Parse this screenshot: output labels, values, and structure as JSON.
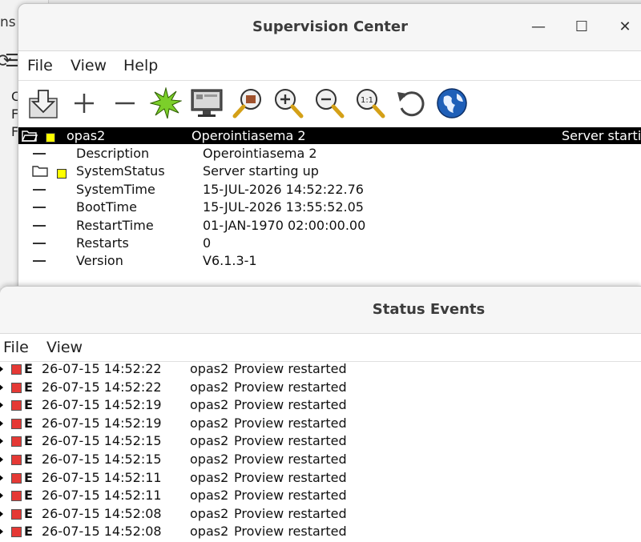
{
  "background_window": {
    "title_fragment": "ns",
    "letters": [
      "C",
      "F",
      "F"
    ]
  },
  "supervision": {
    "title": "Supervision Center",
    "controls": {
      "minimize": "—",
      "maximize": "☐",
      "close": "✕"
    },
    "menu": [
      "File",
      "View",
      "Help"
    ],
    "toolbar": [
      "download-icon",
      "add-icon",
      "remove-icon",
      "burst-icon",
      "monitor-icon",
      "zoom-object-icon",
      "zoom-in-icon",
      "zoom-out-icon",
      "zoom-reset-icon",
      "undo-icon",
      "globe-icon"
    ],
    "node": {
      "name": "opas2",
      "description": "Operointiasema 2",
      "status": "Server starting up",
      "status_color": "#ffff00"
    },
    "properties": [
      {
        "name": "Description",
        "value": "Operointiasema 2",
        "icon": "dash"
      },
      {
        "name": "SystemStatus",
        "value": "Server starting up",
        "icon": "folder"
      },
      {
        "name": "SystemTime",
        "value": "15-JUL-2026 14:52:22.76",
        "icon": "dash"
      },
      {
        "name": "BootTime",
        "value": "15-JUL-2026 13:55:52.05",
        "icon": "dash"
      },
      {
        "name": "RestartTime",
        "value": "01-JAN-1970 02:00:00.00",
        "icon": "dash"
      },
      {
        "name": "Restarts",
        "value": "0",
        "icon": "dash"
      },
      {
        "name": "Version",
        "value": "V6.1.3-1",
        "icon": "dash"
      }
    ]
  },
  "events": {
    "title": "Status Events",
    "menu": [
      "File",
      "View"
    ],
    "severity_color": "#e53935",
    "rows": [
      {
        "code": "E",
        "time": "26-07-15 14:52:22",
        "node": "opas2",
        "text": "Proview restarted"
      },
      {
        "code": "E",
        "time": "26-07-15 14:52:22",
        "node": "opas2",
        "text": "Proview restarted"
      },
      {
        "code": "E",
        "time": "26-07-15 14:52:19",
        "node": "opas2",
        "text": "Proview restarted"
      },
      {
        "code": "E",
        "time": "26-07-15 14:52:19",
        "node": "opas2",
        "text": "Proview restarted"
      },
      {
        "code": "E",
        "time": "26-07-15 14:52:15",
        "node": "opas2",
        "text": "Proview restarted"
      },
      {
        "code": "E",
        "time": "26-07-15 14:52:15",
        "node": "opas2",
        "text": "Proview restarted"
      },
      {
        "code": "E",
        "time": "26-07-15 14:52:11",
        "node": "opas2",
        "text": "Proview restarted"
      },
      {
        "code": "E",
        "time": "26-07-15 14:52:11",
        "node": "opas2",
        "text": "Proview restarted"
      },
      {
        "code": "E",
        "time": "26-07-15 14:52:08",
        "node": "opas2",
        "text": "Proview restarted"
      },
      {
        "code": "E",
        "time": "26-07-15 14:52:08",
        "node": "opas2",
        "text": "Proview restarted"
      }
    ]
  }
}
